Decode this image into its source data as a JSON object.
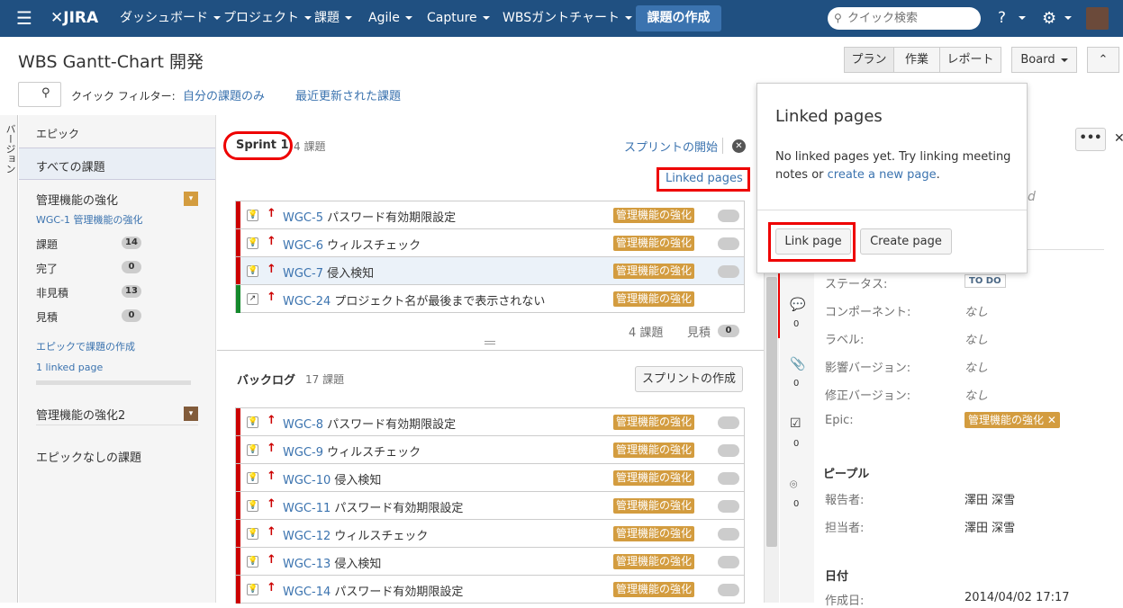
{
  "nav": {
    "logo": "JIRA",
    "items": [
      "ダッシュボード",
      "プロジェクト",
      "課題",
      "Agile",
      "Capture",
      "WBSガントチャート"
    ],
    "create_label": "課題の作成",
    "search_placeholder": "クイック検索"
  },
  "header": {
    "title": "WBS Gantt-Chart 開発",
    "view_buttons": [
      "プラン",
      "作業",
      "レポート"
    ],
    "board_label": "Board"
  },
  "filters": {
    "label": "クイック フィルター:",
    "items": [
      "自分の課題のみ",
      "最近更新された課題"
    ]
  },
  "vertical_tab": "バージョン",
  "epics": {
    "heading": "エピック",
    "all_issues": "すべての課題",
    "epic1_name": "管理機能の強化",
    "epic1_key": "WGC-1 管理機能の強化",
    "stats": [
      {
        "label": "課題",
        "count": "14"
      },
      {
        "label": "完了",
        "count": "0"
      },
      {
        "label": "非見積",
        "count": "13"
      },
      {
        "label": "見積",
        "count": "0"
      }
    ],
    "create_in_epic": "エピックで課題の作成",
    "linked_page": "1 linked page",
    "epic2_name": "管理機能の強化2",
    "no_epic": "エピックなしの課題"
  },
  "sprint": {
    "name": "Sprint 1",
    "count": "4 課題",
    "start_label": "スプリントの開始",
    "linked_pages_label": "Linked pages",
    "footer_count": "4 課題",
    "footer_est_label": "見積",
    "footer_est_value": "0",
    "issues": [
      {
        "key": "WGC-5",
        "summary": "パスワード有効期限設定",
        "epic": "管理機能の強化"
      },
      {
        "key": "WGC-6",
        "summary": "ウィルスチェック",
        "epic": "管理機能の強化"
      },
      {
        "key": "WGC-7",
        "summary": "侵入検知",
        "epic": "管理機能の強化"
      },
      {
        "key": "WGC-24",
        "summary": "プロジェクト名が最後まで表示されない",
        "epic": "管理機能の強化"
      }
    ]
  },
  "backlog": {
    "name": "バックログ",
    "count": "17 課題",
    "create_sprint_label": "スプリントの作成",
    "issues": [
      {
        "key": "WGC-8",
        "summary": "パスワード有効期限設定",
        "epic": "管理機能の強化"
      },
      {
        "key": "WGC-9",
        "summary": "ウィルスチェック",
        "epic": "管理機能の強化"
      },
      {
        "key": "WGC-10",
        "summary": "侵入検知",
        "epic": "管理機能の強化"
      },
      {
        "key": "WGC-11",
        "summary": "パスワード有効期限設定",
        "epic": "管理機能の強化"
      },
      {
        "key": "WGC-12",
        "summary": "ウィルスチェック",
        "epic": "管理機能の強化"
      },
      {
        "key": "WGC-13",
        "summary": "侵入検知",
        "epic": "管理機能の強化"
      },
      {
        "key": "WGC-14",
        "summary": "パスワード有効期限設定",
        "epic": "管理機能の強化"
      }
    ]
  },
  "detail": {
    "fields": [
      {
        "label": "ステータス:",
        "value": "TO DO"
      },
      {
        "label": "コンポーネント:",
        "value": "なし"
      },
      {
        "label": "ラベル:",
        "value": "なし"
      },
      {
        "label": "影響バージョン:",
        "value": "なし"
      },
      {
        "label": "修正バージョン:",
        "value": "なし"
      },
      {
        "label": "Epic:",
        "value": "管理機能の強化"
      }
    ],
    "people_heading": "ピープル",
    "reporter_label": "報告者:",
    "reporter": "澤田 深雪",
    "assignee_label": "担当者:",
    "assignee": "澤田 深雪",
    "dates_heading": "日付",
    "created_label": "作成日:",
    "created": "2014/04/02 17:17",
    "tab_counts": [
      "0",
      "0",
      "0",
      "0"
    ],
    "partial_text": "d"
  },
  "popup": {
    "title": "Linked pages",
    "body": "No linked pages yet. Try linking meeting notes or",
    "link_text": "create a new page",
    "link_page_label": "Link page",
    "create_page_label": "Create page"
  },
  "colors": {
    "nav": "#205081",
    "epic_lozenge": "#d39c3f",
    "highlight": "#e00000"
  }
}
